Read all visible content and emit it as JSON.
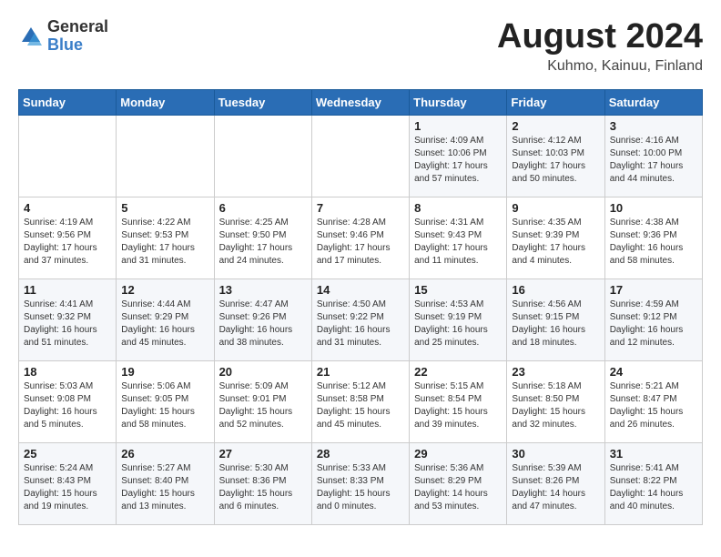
{
  "logo": {
    "general": "General",
    "blue": "Blue"
  },
  "title": {
    "month_year": "August 2024",
    "location": "Kuhmo, Kainuu, Finland"
  },
  "headers": [
    "Sunday",
    "Monday",
    "Tuesday",
    "Wednesday",
    "Thursday",
    "Friday",
    "Saturday"
  ],
  "weeks": [
    [
      {
        "day": "",
        "detail": ""
      },
      {
        "day": "",
        "detail": ""
      },
      {
        "day": "",
        "detail": ""
      },
      {
        "day": "",
        "detail": ""
      },
      {
        "day": "1",
        "detail": "Sunrise: 4:09 AM\nSunset: 10:06 PM\nDaylight: 17 hours\nand 57 minutes."
      },
      {
        "day": "2",
        "detail": "Sunrise: 4:12 AM\nSunset: 10:03 PM\nDaylight: 17 hours\nand 50 minutes."
      },
      {
        "day": "3",
        "detail": "Sunrise: 4:16 AM\nSunset: 10:00 PM\nDaylight: 17 hours\nand 44 minutes."
      }
    ],
    [
      {
        "day": "4",
        "detail": "Sunrise: 4:19 AM\nSunset: 9:56 PM\nDaylight: 17 hours\nand 37 minutes."
      },
      {
        "day": "5",
        "detail": "Sunrise: 4:22 AM\nSunset: 9:53 PM\nDaylight: 17 hours\nand 31 minutes."
      },
      {
        "day": "6",
        "detail": "Sunrise: 4:25 AM\nSunset: 9:50 PM\nDaylight: 17 hours\nand 24 minutes."
      },
      {
        "day": "7",
        "detail": "Sunrise: 4:28 AM\nSunset: 9:46 PM\nDaylight: 17 hours\nand 17 minutes."
      },
      {
        "day": "8",
        "detail": "Sunrise: 4:31 AM\nSunset: 9:43 PM\nDaylight: 17 hours\nand 11 minutes."
      },
      {
        "day": "9",
        "detail": "Sunrise: 4:35 AM\nSunset: 9:39 PM\nDaylight: 17 hours\nand 4 minutes."
      },
      {
        "day": "10",
        "detail": "Sunrise: 4:38 AM\nSunset: 9:36 PM\nDaylight: 16 hours\nand 58 minutes."
      }
    ],
    [
      {
        "day": "11",
        "detail": "Sunrise: 4:41 AM\nSunset: 9:32 PM\nDaylight: 16 hours\nand 51 minutes."
      },
      {
        "day": "12",
        "detail": "Sunrise: 4:44 AM\nSunset: 9:29 PM\nDaylight: 16 hours\nand 45 minutes."
      },
      {
        "day": "13",
        "detail": "Sunrise: 4:47 AM\nSunset: 9:26 PM\nDaylight: 16 hours\nand 38 minutes."
      },
      {
        "day": "14",
        "detail": "Sunrise: 4:50 AM\nSunset: 9:22 PM\nDaylight: 16 hours\nand 31 minutes."
      },
      {
        "day": "15",
        "detail": "Sunrise: 4:53 AM\nSunset: 9:19 PM\nDaylight: 16 hours\nand 25 minutes."
      },
      {
        "day": "16",
        "detail": "Sunrise: 4:56 AM\nSunset: 9:15 PM\nDaylight: 16 hours\nand 18 minutes."
      },
      {
        "day": "17",
        "detail": "Sunrise: 4:59 AM\nSunset: 9:12 PM\nDaylight: 16 hours\nand 12 minutes."
      }
    ],
    [
      {
        "day": "18",
        "detail": "Sunrise: 5:03 AM\nSunset: 9:08 PM\nDaylight: 16 hours\nand 5 minutes."
      },
      {
        "day": "19",
        "detail": "Sunrise: 5:06 AM\nSunset: 9:05 PM\nDaylight: 15 hours\nand 58 minutes."
      },
      {
        "day": "20",
        "detail": "Sunrise: 5:09 AM\nSunset: 9:01 PM\nDaylight: 15 hours\nand 52 minutes."
      },
      {
        "day": "21",
        "detail": "Sunrise: 5:12 AM\nSunset: 8:58 PM\nDaylight: 15 hours\nand 45 minutes."
      },
      {
        "day": "22",
        "detail": "Sunrise: 5:15 AM\nSunset: 8:54 PM\nDaylight: 15 hours\nand 39 minutes."
      },
      {
        "day": "23",
        "detail": "Sunrise: 5:18 AM\nSunset: 8:50 PM\nDaylight: 15 hours\nand 32 minutes."
      },
      {
        "day": "24",
        "detail": "Sunrise: 5:21 AM\nSunset: 8:47 PM\nDaylight: 15 hours\nand 26 minutes."
      }
    ],
    [
      {
        "day": "25",
        "detail": "Sunrise: 5:24 AM\nSunset: 8:43 PM\nDaylight: 15 hours\nand 19 minutes."
      },
      {
        "day": "26",
        "detail": "Sunrise: 5:27 AM\nSunset: 8:40 PM\nDaylight: 15 hours\nand 13 minutes."
      },
      {
        "day": "27",
        "detail": "Sunrise: 5:30 AM\nSunset: 8:36 PM\nDaylight: 15 hours\nand 6 minutes."
      },
      {
        "day": "28",
        "detail": "Sunrise: 5:33 AM\nSunset: 8:33 PM\nDaylight: 15 hours\nand 0 minutes."
      },
      {
        "day": "29",
        "detail": "Sunrise: 5:36 AM\nSunset: 8:29 PM\nDaylight: 14 hours\nand 53 minutes."
      },
      {
        "day": "30",
        "detail": "Sunrise: 5:39 AM\nSunset: 8:26 PM\nDaylight: 14 hours\nand 47 minutes."
      },
      {
        "day": "31",
        "detail": "Sunrise: 5:41 AM\nSunset: 8:22 PM\nDaylight: 14 hours\nand 40 minutes."
      }
    ]
  ]
}
